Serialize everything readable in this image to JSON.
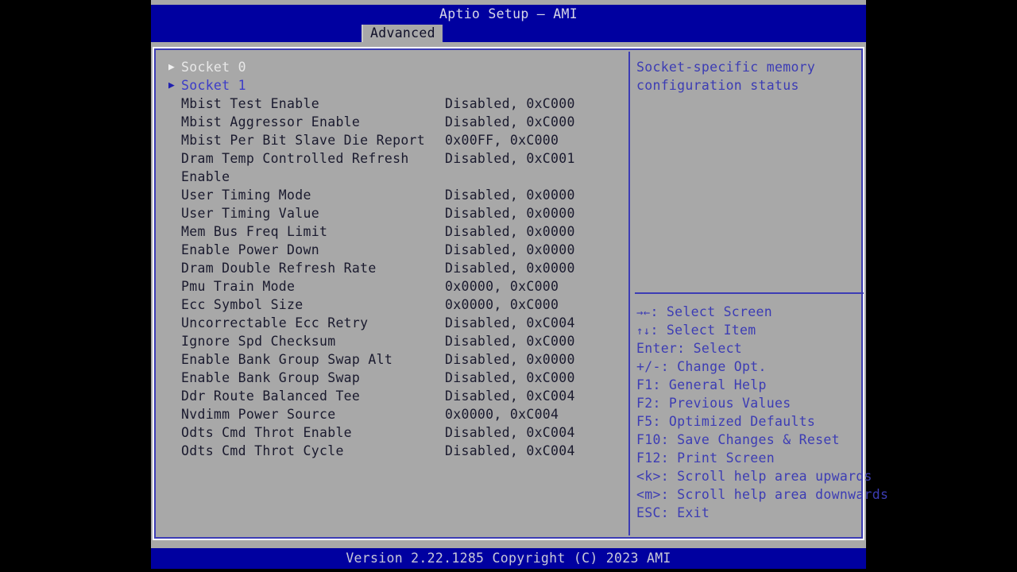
{
  "header": {
    "title": "Aptio Setup – AMI",
    "tab_label": "Advanced"
  },
  "menu": {
    "items": [
      {
        "label": "Socket 0",
        "value": "",
        "arrow": "submenu-arrow",
        "selected": false,
        "style": "white"
      },
      {
        "label": "Socket 1",
        "value": "",
        "arrow": "submenu-arrow",
        "selected": true,
        "style": "selected"
      },
      {
        "label": "Mbist Test Enable",
        "value": "Disabled, 0xC000",
        "arrow": "",
        "selected": false,
        "style": "normal"
      },
      {
        "label": "Mbist Aggressor Enable",
        "value": "Disabled, 0xC000",
        "arrow": "",
        "selected": false,
        "style": "normal"
      },
      {
        "label": "Mbist Per Bit Slave Die Report",
        "value": "0x00FF, 0xC000",
        "arrow": "",
        "selected": false,
        "style": "normal"
      },
      {
        "label": "Dram Temp Controlled Refresh",
        "value": "Disabled, 0xC001",
        "arrow": "",
        "selected": false,
        "style": "normal"
      },
      {
        "label": "Enable",
        "value": "",
        "arrow": "",
        "selected": false,
        "style": "normal"
      },
      {
        "label": "User Timing Mode",
        "value": "Disabled, 0x0000",
        "arrow": "",
        "selected": false,
        "style": "normal"
      },
      {
        "label": "User Timing Value",
        "value": "Disabled, 0x0000",
        "arrow": "",
        "selected": false,
        "style": "normal"
      },
      {
        "label": "Mem Bus Freq Limit",
        "value": "Disabled, 0x0000",
        "arrow": "",
        "selected": false,
        "style": "normal"
      },
      {
        "label": "Enable Power Down",
        "value": "Disabled, 0x0000",
        "arrow": "",
        "selected": false,
        "style": "normal"
      },
      {
        "label": "Dram Double Refresh Rate",
        "value": "Disabled, 0x0000",
        "arrow": "",
        "selected": false,
        "style": "normal"
      },
      {
        "label": "Pmu Train Mode",
        "value": "0x0000, 0xC000",
        "arrow": "",
        "selected": false,
        "style": "normal"
      },
      {
        "label": "Ecc Symbol Size",
        "value": "0x0000, 0xC000",
        "arrow": "",
        "selected": false,
        "style": "normal"
      },
      {
        "label": "Uncorrectable Ecc Retry",
        "value": "Disabled, 0xC004",
        "arrow": "",
        "selected": false,
        "style": "normal"
      },
      {
        "label": "Ignore Spd Checksum",
        "value": "Disabled, 0xC000",
        "arrow": "",
        "selected": false,
        "style": "normal"
      },
      {
        "label": "Enable Bank Group Swap Alt",
        "value": "Disabled, 0x0000",
        "arrow": "",
        "selected": false,
        "style": "normal"
      },
      {
        "label": "Enable Bank Group Swap",
        "value": "Disabled, 0xC000",
        "arrow": "",
        "selected": false,
        "style": "normal"
      },
      {
        "label": "Ddr Route Balanced Tee",
        "value": "Disabled, 0xC004",
        "arrow": "",
        "selected": false,
        "style": "normal"
      },
      {
        "label": "Nvdimm Power Source",
        "value": "0x0000, 0xC004",
        "arrow": "",
        "selected": false,
        "style": "normal"
      },
      {
        "label": "Odts Cmd Throt Enable",
        "value": "Disabled, 0xC004",
        "arrow": "",
        "selected": false,
        "style": "normal"
      },
      {
        "label": "Odts Cmd Throt Cycle",
        "value": "Disabled, 0xC004",
        "arrow": "",
        "selected": false,
        "style": "normal"
      }
    ]
  },
  "help": {
    "description": "Socket-specific memory\nconfiguration status",
    "keys": [
      {
        "glyph": "→←",
        "text": ": Select Screen"
      },
      {
        "glyph": "↑↓",
        "text": ": Select Item"
      },
      {
        "glyph": "",
        "text": "Enter: Select"
      },
      {
        "glyph": "",
        "text": "+/-: Change Opt."
      },
      {
        "glyph": "",
        "text": "F1: General Help"
      },
      {
        "glyph": "",
        "text": "F2: Previous Values"
      },
      {
        "glyph": "",
        "text": "F5: Optimized Defaults"
      },
      {
        "glyph": "",
        "text": "F10: Save Changes & Reset"
      },
      {
        "glyph": "",
        "text": "F12: Print Screen"
      },
      {
        "glyph": "",
        "text": "<k>: Scroll help area upwards"
      },
      {
        "glyph": "",
        "text": "<m>: Scroll help area downwards"
      },
      {
        "glyph": "",
        "text": "ESC: Exit"
      }
    ]
  },
  "footer": {
    "version_text": "Version 2.22.1285 Copyright (C) 2023 AMI"
  },
  "colors": {
    "header_blue": "#0000a0",
    "panel_gray": "#a8a8a8",
    "accent_blue": "#3c3cb4",
    "text_dark": "#1a1a2e",
    "text_selected": "#3c3cc8"
  }
}
